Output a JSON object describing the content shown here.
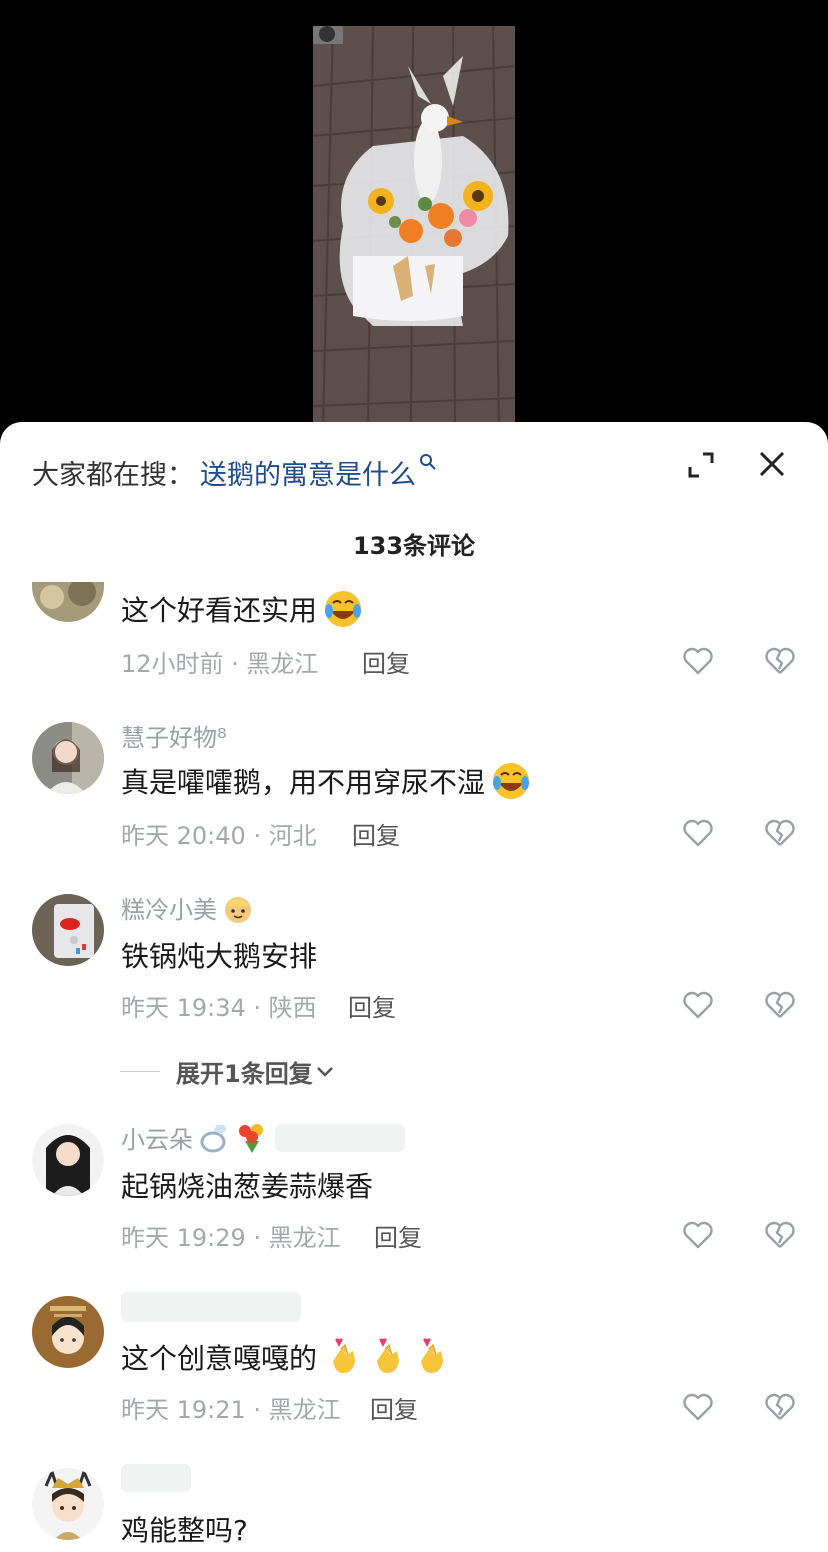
{
  "sheet": {
    "search_label": "大家都在搜：",
    "search_query": "送鹅的寓意是什么",
    "comment_count": "133条评论",
    "icons": {
      "expand": "expand-icon",
      "close": "close-icon",
      "search": "search-icon"
    }
  },
  "comments": [
    {
      "user": "",
      "text": "这个好看还实用",
      "emoji": "laughing-crying-emoji",
      "meta": "12小时前 · 黑龙江",
      "reply": "回复"
    },
    {
      "user": "慧子好物⁸",
      "text": "真是嚯嚯鹅，用不用穿尿不湿",
      "emoji": "laughing-crying-emoji",
      "meta": "昨天 20:40 · 河北",
      "reply": "回复"
    },
    {
      "user": "糕冷小美",
      "user_badge": "baby-emoji",
      "text": "铁锅炖大鹅安排",
      "meta": "昨天 19:34 · 陕西",
      "reply": "回复"
    },
    {
      "user": "小云朵",
      "user_badges": [
        "ring-emoji",
        "bouquet-emoji"
      ],
      "text": "起锅烧油葱姜蒜爆香",
      "meta": "昨天 19:29 · 黑龙江",
      "reply": "回复"
    },
    {
      "user": "",
      "text": "这个创意嘎嘎的",
      "emoji": "finger-heart-emoji",
      "meta": "昨天 19:21 · 黑龙江",
      "reply": "回复"
    },
    {
      "user": "",
      "text": "鸡能整吗?",
      "meta": "",
      "reply": ""
    }
  ],
  "expand_replies": "展开1条回复",
  "colors": {
    "link": "#1f4c8f",
    "meta": "#a4a8ad",
    "text": "#1a1a1a"
  }
}
